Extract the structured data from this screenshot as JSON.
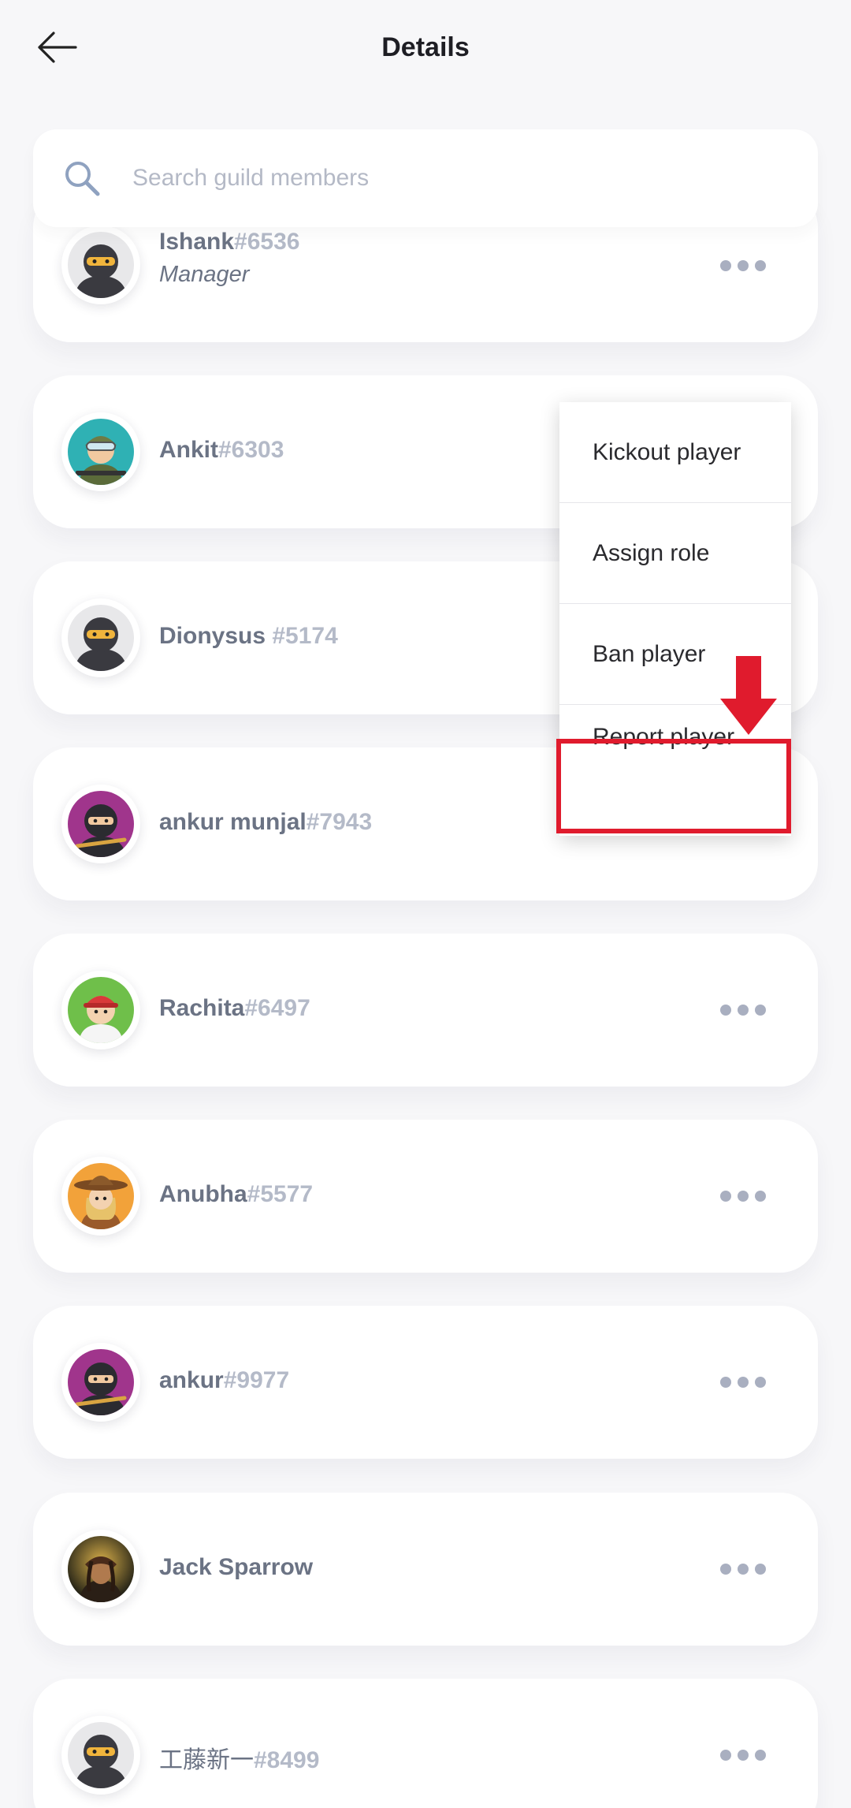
{
  "header": {
    "title": "Details"
  },
  "search": {
    "placeholder": "Search guild members"
  },
  "members": [
    {
      "name": "Ishank",
      "tag": "#6536",
      "role": "Manager",
      "avatar": "ninja-grey-icon"
    },
    {
      "name": "Ankit",
      "tag": "#6303",
      "role": "",
      "avatar": "soldier-icon"
    },
    {
      "name": "Dionysus ",
      "tag": "#5174",
      "role": "",
      "avatar": "ninja-grey-icon"
    },
    {
      "name": "ankur munjal",
      "tag": "#7943",
      "role": "",
      "avatar": "ninja-purple-icon"
    },
    {
      "name": "Rachita",
      "tag": "#6497",
      "role": "",
      "avatar": "boy-red-cap-icon"
    },
    {
      "name": "Anubha",
      "tag": "#5577",
      "role": "",
      "avatar": "cowgirl-icon"
    },
    {
      "name": "ankur",
      "tag": "#9977",
      "role": "",
      "avatar": "ninja-purple-icon"
    },
    {
      "name": "Jack Sparrow",
      "tag": "",
      "role": "",
      "avatar": "pirate-photo-icon"
    },
    {
      "name": "工藤新一",
      "tag": "#8499",
      "role": "",
      "avatar": "ninja-grey-icon"
    }
  ],
  "menu": {
    "items": [
      {
        "label": "Kickout player"
      },
      {
        "label": "Assign role"
      },
      {
        "label": "Ban player"
      },
      {
        "label": "Report player"
      }
    ],
    "highlight_color": "#e01b2d"
  },
  "colors": {
    "background": "#f7f7f9",
    "card": "#ffffff",
    "name": "#6b7384",
    "tag": "#b4bac8",
    "dots": "#a9afc0"
  }
}
